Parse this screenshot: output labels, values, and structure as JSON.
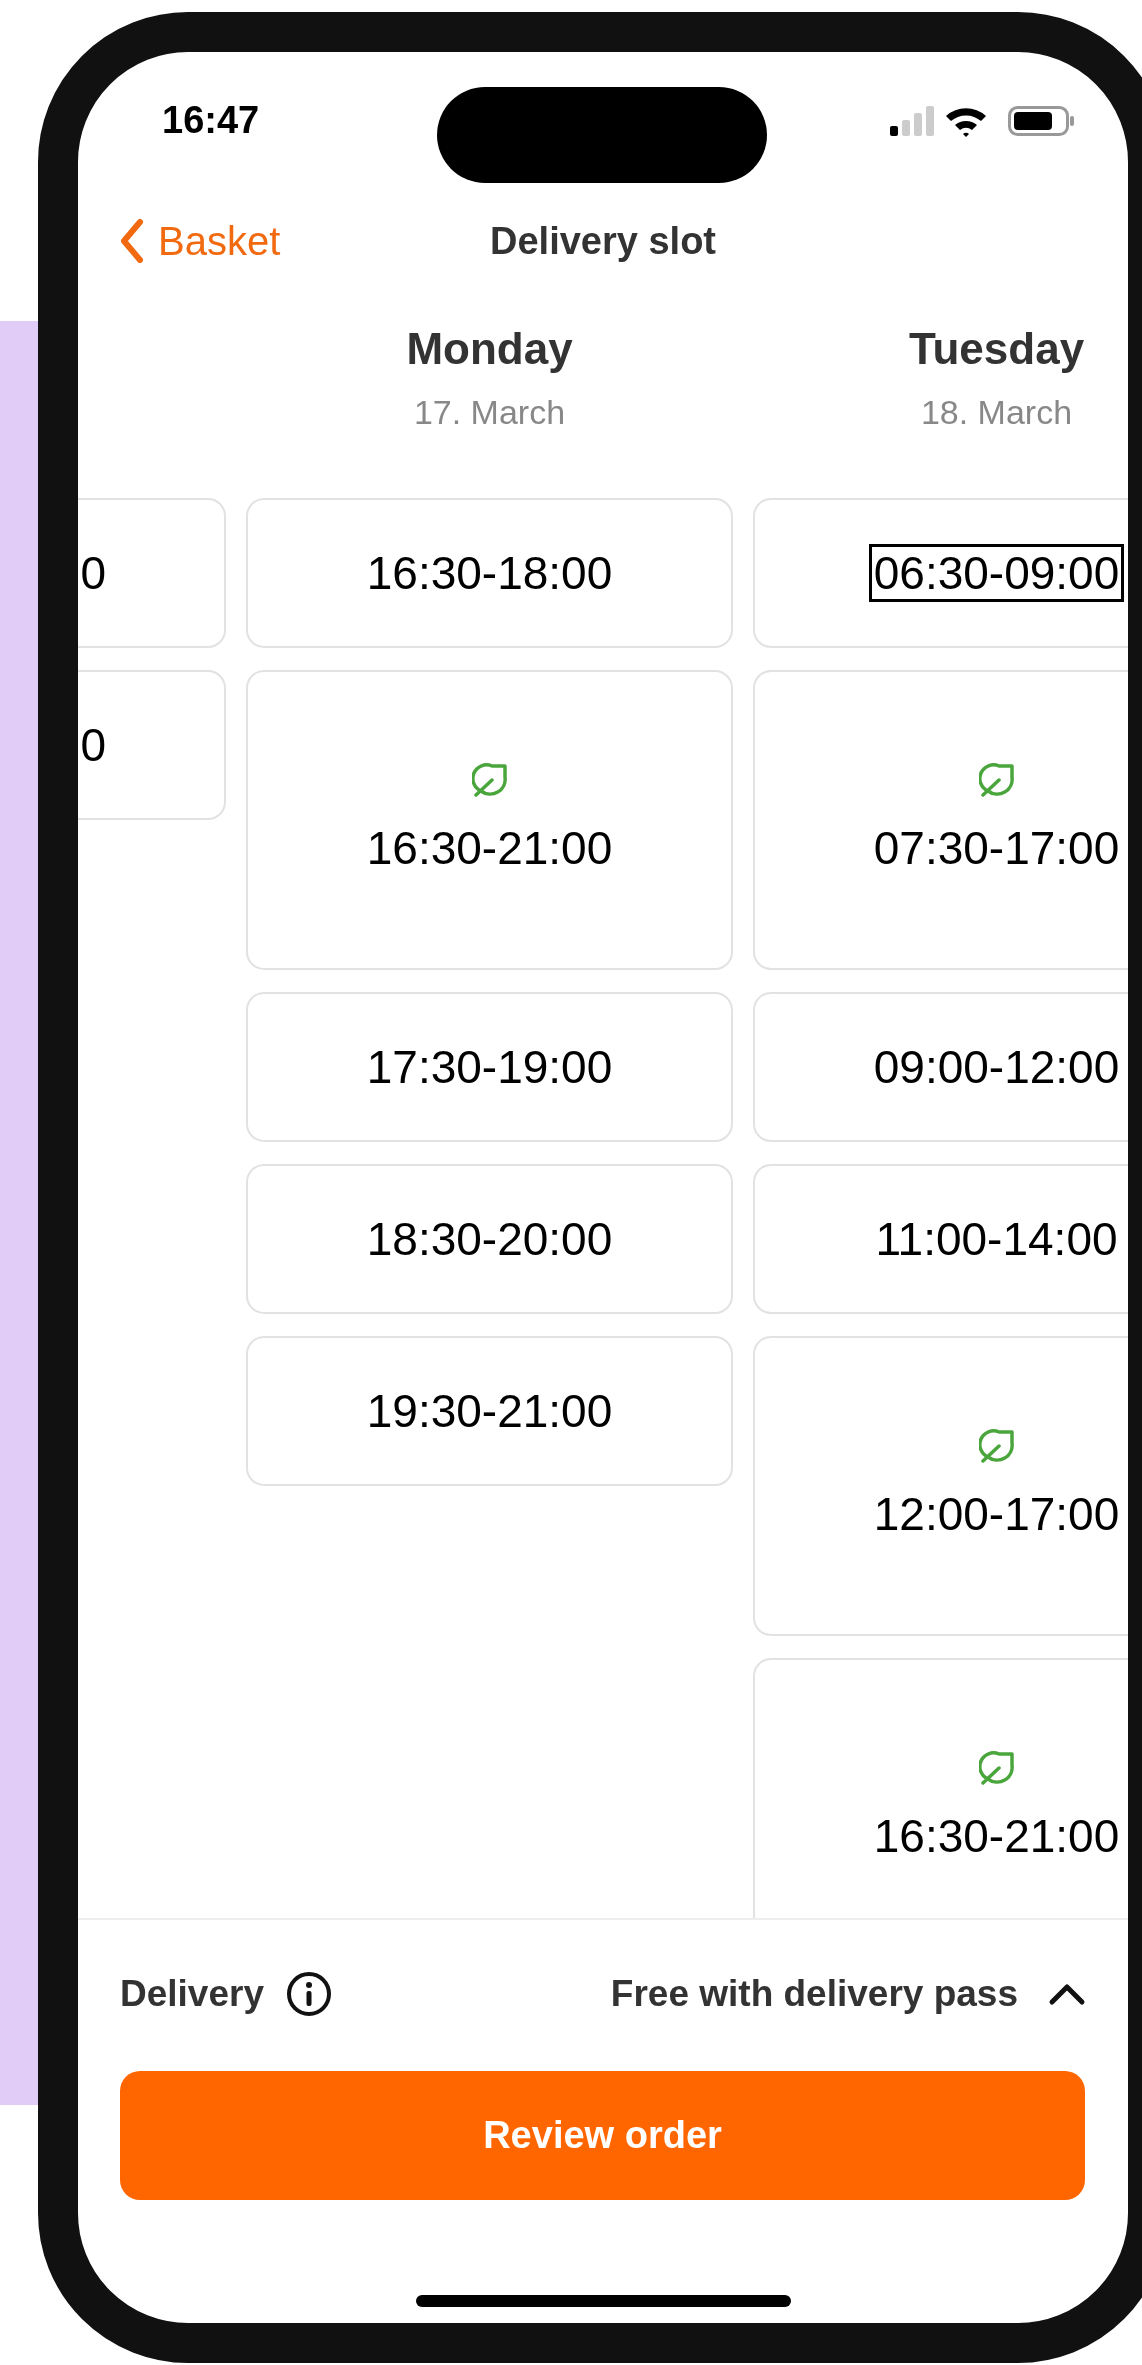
{
  "status_bar": {
    "time": "16:47"
  },
  "nav": {
    "back_label": "Basket",
    "title": "Delivery slot"
  },
  "days": [
    {
      "cut_off": true,
      "slots": [
        {
          "time": "0",
          "eco": false,
          "focused": false
        },
        {
          "time": "0",
          "eco": false,
          "focused": false
        }
      ]
    },
    {
      "weekday": "Monday",
      "date": "17. March",
      "cut_off": false,
      "slots": [
        {
          "time": "16:30-18:00",
          "eco": false,
          "focused": false
        },
        {
          "time": "16:30-21:00",
          "eco": true,
          "focused": false
        },
        {
          "time": "17:30-19:00",
          "eco": false,
          "focused": false
        },
        {
          "time": "18:30-20:00",
          "eco": false,
          "focused": false
        },
        {
          "time": "19:30-21:00",
          "eco": false,
          "focused": false
        }
      ]
    },
    {
      "weekday": "Tuesday",
      "date": "18. March",
      "cut_off": false,
      "slots": [
        {
          "time": "06:30-09:00",
          "eco": false,
          "focused": true
        },
        {
          "time": "07:30-17:00",
          "eco": true,
          "focused": false
        },
        {
          "time": "09:00-12:00",
          "eco": false,
          "focused": false
        },
        {
          "time": "11:00-14:00",
          "eco": false,
          "focused": false
        },
        {
          "time": "12:00-17:00",
          "eco": true,
          "focused": false
        },
        {
          "time": "16:30-21:00",
          "eco": true,
          "focused": false
        }
      ]
    }
  ],
  "footer": {
    "label": "Delivery",
    "price": "Free with delivery pass",
    "button": "Review order"
  }
}
